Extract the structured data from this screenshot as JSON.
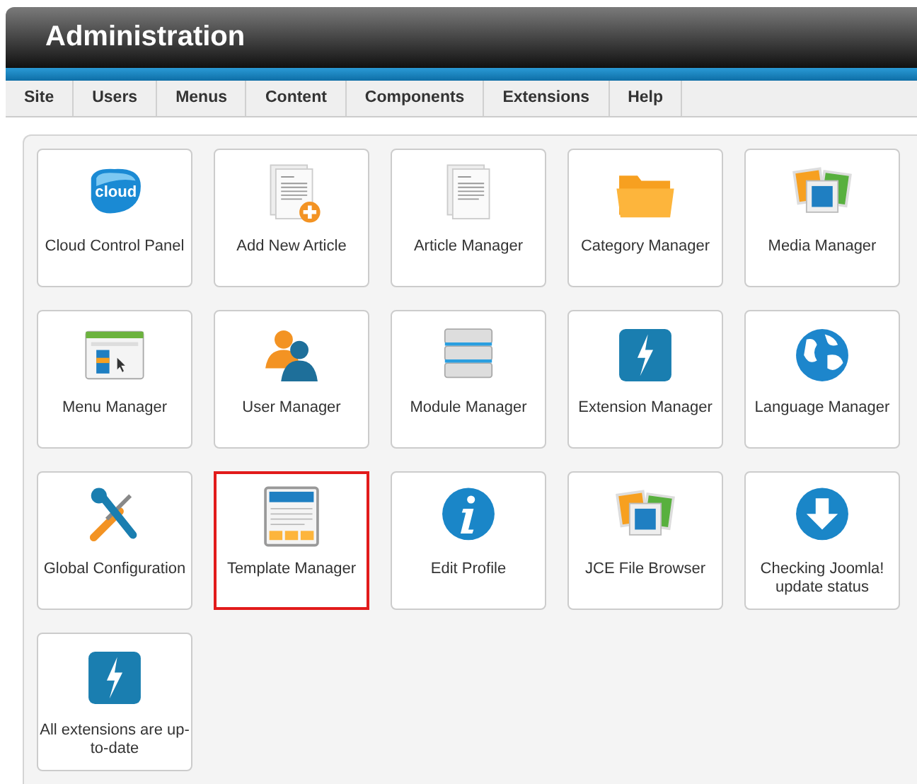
{
  "header": {
    "title": "Administration"
  },
  "menu": [
    {
      "label": "Site"
    },
    {
      "label": "Users"
    },
    {
      "label": "Menus"
    },
    {
      "label": "Content"
    },
    {
      "label": "Components"
    },
    {
      "label": "Extensions"
    },
    {
      "label": "Help"
    }
  ],
  "tiles": [
    {
      "label": "Cloud Control Panel",
      "kind": "cloud",
      "logo_text": "cloud",
      "highlighted": false
    },
    {
      "label": "Add New Article",
      "kind": "add-article",
      "highlighted": false
    },
    {
      "label": "Article Manager",
      "kind": "article",
      "highlighted": false
    },
    {
      "label": "Category Manager",
      "kind": "folder",
      "highlighted": false
    },
    {
      "label": "Media Manager",
      "kind": "media",
      "highlighted": false
    },
    {
      "label": "Menu Manager",
      "kind": "menu",
      "highlighted": false
    },
    {
      "label": "User Manager",
      "kind": "users",
      "highlighted": false
    },
    {
      "label": "Module Manager",
      "kind": "module",
      "highlighted": false
    },
    {
      "label": "Extension Manager",
      "kind": "bolt",
      "highlighted": false
    },
    {
      "label": "Language Manager",
      "kind": "globe",
      "highlighted": false
    },
    {
      "label": "Global Configuration",
      "kind": "tools",
      "highlighted": false
    },
    {
      "label": "Template Manager",
      "kind": "template",
      "highlighted": true
    },
    {
      "label": "Edit Profile",
      "kind": "info",
      "highlighted": false
    },
    {
      "label": "JCE File Browser",
      "kind": "media",
      "highlighted": false
    },
    {
      "label": "Checking Joomla! update status",
      "kind": "download",
      "highlighted": false
    },
    {
      "label": "All extensions are up-to-date",
      "kind": "bolt",
      "highlighted": false
    }
  ]
}
